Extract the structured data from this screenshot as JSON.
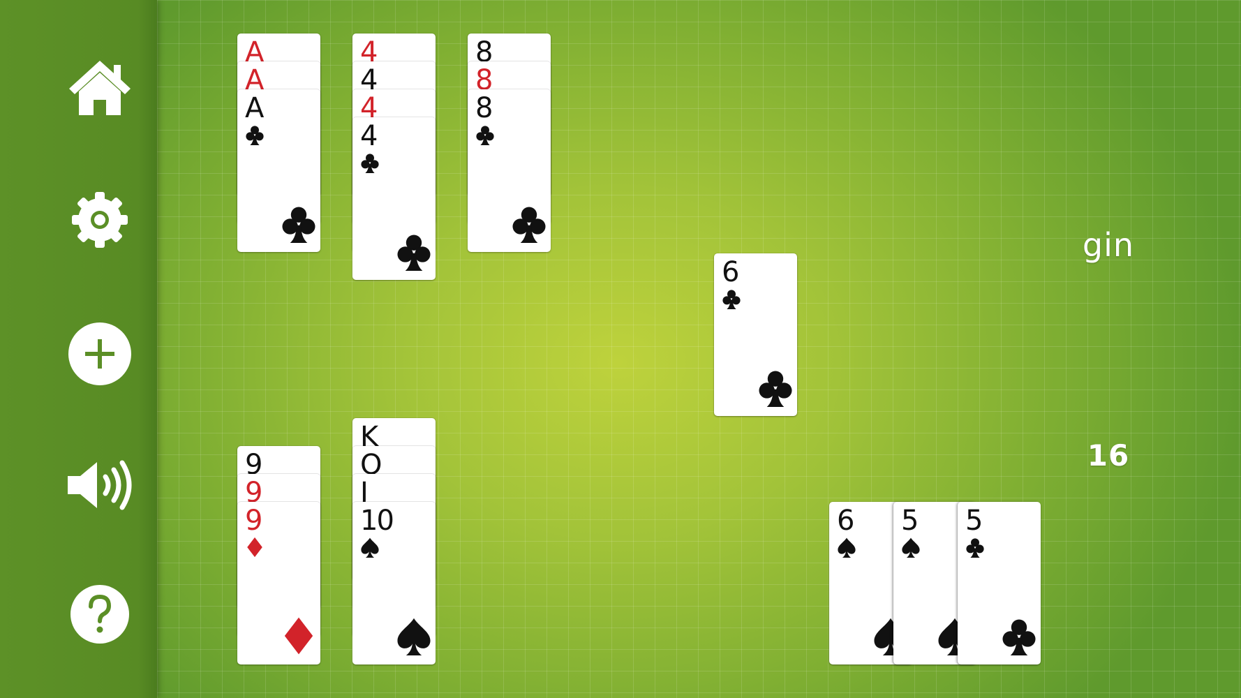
{
  "sidebar": {
    "buttons": [
      {
        "icon": "home-icon"
      },
      {
        "icon": "gear-icon"
      },
      {
        "icon": "plus-icon"
      },
      {
        "icon": "speaker-icon"
      },
      {
        "icon": "help-icon"
      }
    ]
  },
  "colors": {
    "red_suit": "#d2232a",
    "black_suit": "#111111",
    "felt": "#a2c339",
    "sidebar": "#588b24"
  },
  "opponent_melds": [
    {
      "name": "meld-aces",
      "cards": [
        {
          "rank": "A",
          "suit": "diamonds"
        },
        {
          "rank": "A",
          "suit": "hearts"
        },
        {
          "rank": "A",
          "suit": "clubs"
        }
      ]
    },
    {
      "name": "meld-fours",
      "cards": [
        {
          "rank": "4",
          "suit": "diamonds"
        },
        {
          "rank": "4",
          "suit": "spades"
        },
        {
          "rank": "4",
          "suit": "hearts"
        },
        {
          "rank": "4",
          "suit": "clubs"
        }
      ]
    },
    {
      "name": "meld-eights",
      "cards": [
        {
          "rank": "8",
          "suit": "spades"
        },
        {
          "rank": "8",
          "suit": "hearts"
        },
        {
          "rank": "8",
          "suit": "clubs"
        }
      ]
    }
  ],
  "discard_card": {
    "rank": "6",
    "suit": "clubs"
  },
  "player_melds": [
    {
      "name": "meld-nines",
      "cards": [
        {
          "rank": "9",
          "suit": "spades"
        },
        {
          "rank": "9",
          "suit": "hearts"
        },
        {
          "rank": "9",
          "suit": "diamonds"
        }
      ]
    },
    {
      "name": "meld-spade-run",
      "cards": [
        {
          "rank": "K",
          "suit": "spades"
        },
        {
          "rank": "Q",
          "suit": "spades"
        },
        {
          "rank": "J",
          "suit": "spades"
        },
        {
          "rank": "10",
          "suit": "spades"
        }
      ]
    }
  ],
  "deadwood_cards": [
    {
      "rank": "6",
      "suit": "spades"
    },
    {
      "rank": "5",
      "suit": "spades"
    },
    {
      "rank": "5",
      "suit": "clubs"
    }
  ],
  "status": {
    "gin_label": "gin",
    "score": "16"
  }
}
